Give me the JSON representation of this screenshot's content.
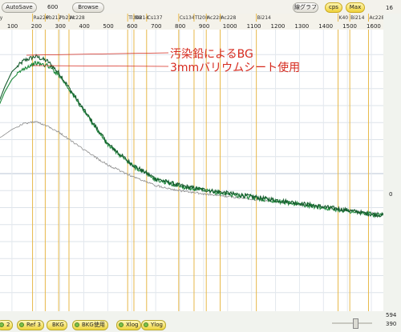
{
  "toolbar": {
    "autosave_label": "AutoSave",
    "seconds_value": "600",
    "browse_label": "Browse",
    "graph_label": "線グラフ",
    "cps_label": "cps",
    "max_label": "Max"
  },
  "y_axis": {
    "top_label": "16",
    "zero_label": "0"
  },
  "bottom_readout": {
    "line1": "594",
    "line2": "390"
  },
  "bottom_bar": {
    "ref2_label": "2",
    "ref3_label": "Ref 3",
    "bkg_label": "BKG",
    "bkg_use_label": "BKG使用",
    "xlog_label": "Xlog",
    "ylog_label": "Ylog"
  },
  "annotations": [
    "汚染鉛によるBG",
    "3mmバリウムシート使用"
  ],
  "colors": {
    "accent_yellow": "#f0d23a",
    "series_green": "#1e8a3c",
    "series_dark_green": "#165c2e",
    "series_gray": "#8c8c8c",
    "nuclide_line": "#e7b84a",
    "annotation_red": "#d62a1e"
  },
  "chart_data": {
    "type": "line",
    "xlim": [
      0,
      1650
    ],
    "ylim": [
      -16,
      16
    ],
    "grid": true,
    "x_ticks": [
      0,
      100,
      200,
      300,
      400,
      500,
      600,
      700,
      800,
      900,
      1000,
      1100,
      1200,
      1300,
      1400,
      1500,
      1600
    ],
    "x_tick_labels": [
      "",
      "100",
      "200",
      "300",
      "400",
      "500",
      "600",
      "700",
      "800",
      "900",
      "1000",
      "1100",
      "1200",
      "1300",
      "1400",
      "1500",
      "1600"
    ],
    "nuclide_lines": [
      {
        "label": "Ray",
        "x": 20
      },
      {
        "label": "Ra226",
        "x": 186
      },
      {
        "label": "Pb212",
        "x": 239
      },
      {
        "label": "Pb214",
        "x": 295
      },
      {
        "label": "Ac228",
        "x": 338
      },
      {
        "label": "Tl208",
        "x": 583
      },
      {
        "label": "Bi214",
        "x": 609
      },
      {
        "label": "Cs137",
        "x": 662
      },
      {
        "label": "Cs134",
        "x": 796
      },
      {
        "label": "Tl208",
        "x": 860
      },
      {
        "label": "Ac228",
        "x": 911
      },
      {
        "label": "Ac228",
        "x": 969
      },
      {
        "label": "Bi214",
        "x": 1120
      },
      {
        "label": "K40",
        "x": 1461
      },
      {
        "label": "Bi214",
        "x": 1510
      },
      {
        "label": "Ac228",
        "x": 1588
      }
    ],
    "series": [
      {
        "x": [
          0,
          20,
          40,
          70,
          100,
          150,
          200,
          250,
          300,
          400,
          500,
          600,
          700,
          800,
          900,
          1000,
          1100,
          1200,
          1300,
          1400,
          1500,
          1600,
          1650
        ],
        "values": [
          6.6,
          6.0,
          8.0,
          10.2,
          12.0,
          13.3,
          13.8,
          13.2,
          11.7,
          7.5,
          3.5,
          1.1,
          -0.6,
          -1.4,
          -1.9,
          -2.3,
          -2.7,
          -3.1,
          -3.5,
          -3.9,
          -4.3,
          -4.8,
          -4.9
        ]
      },
      {
        "x": [
          0,
          20,
          40,
          70,
          100,
          150,
          200,
          250,
          300,
          400,
          500,
          600,
          700,
          800,
          900,
          1000,
          1100,
          1200,
          1300,
          1400,
          1500,
          1600,
          1650
        ],
        "values": [
          3.0,
          5.2,
          7.6,
          9.6,
          11.1,
          12.4,
          13.0,
          12.7,
          11.5,
          7.4,
          3.4,
          1.0,
          -0.7,
          -1.5,
          -2.0,
          -2.4,
          -2.8,
          -3.2,
          -3.6,
          -4.0,
          -4.4,
          -4.8,
          -4.9
        ]
      },
      {
        "x": [
          0,
          30,
          60,
          100,
          150,
          200,
          250,
          300,
          350,
          400,
          500,
          600,
          700,
          800,
          900,
          1000,
          1100,
          1200,
          1300,
          1400,
          1500,
          1600,
          1650
        ],
        "values": [
          3.5,
          3.9,
          4.4,
          5.2,
          5.9,
          6.1,
          5.6,
          4.8,
          3.8,
          2.8,
          1.0,
          -0.3,
          -1.4,
          -2.0,
          -2.4,
          -2.7,
          -3.0,
          -3.3,
          -3.6,
          -4.0,
          -4.3,
          -4.6,
          -4.7
        ]
      }
    ]
  }
}
